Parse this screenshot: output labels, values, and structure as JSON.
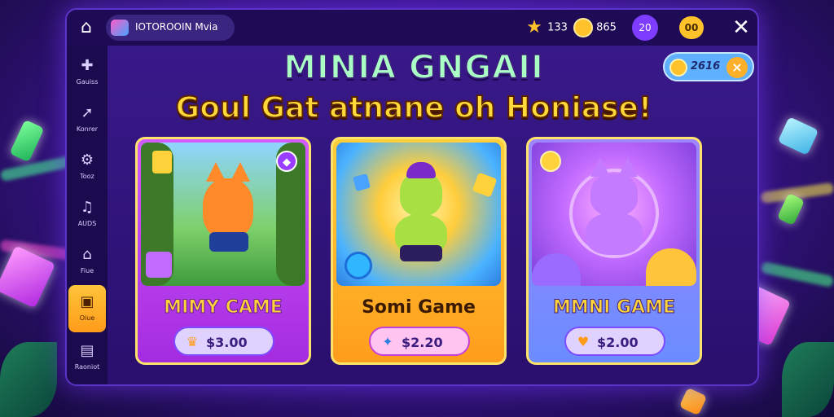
{
  "topbar": {
    "app_title": "IOTOROOIN  Mvia",
    "stats": [
      {
        "icon": "star-icon",
        "value": "133"
      },
      {
        "icon": "coin-icon",
        "value": "865"
      }
    ],
    "purple_badge": "20",
    "gold_badge": "00"
  },
  "sidebar": {
    "items": [
      {
        "icon": "gamepad-icon",
        "label": "Gauiss"
      },
      {
        "icon": "arrow-icon",
        "label": "Konrer"
      },
      {
        "icon": "gear-icon",
        "label": "Tooz"
      },
      {
        "icon": "music-note-icon",
        "label": "AUDS"
      },
      {
        "icon": "home-icon",
        "label": "Fiue"
      },
      {
        "icon": "card-icon",
        "label": "Oiue"
      },
      {
        "icon": "book-icon",
        "label": "Raoniot"
      }
    ],
    "active_index": 5
  },
  "header": {
    "title": "MINIA GNGAII",
    "subtitle": "Goul Gat atnane oh Honiase!"
  },
  "currency": {
    "value": "2616",
    "close": "×"
  },
  "cards": [
    {
      "name": "MIMY CAME",
      "price": "$3.00",
      "price_icon": "crown-icon"
    },
    {
      "name": "Somi Game",
      "price": "$2.20",
      "price_icon": "sparkle-icon"
    },
    {
      "name": "MMNI GAME",
      "price": "$2.00",
      "price_icon": "heart-icon"
    }
  ],
  "colors": {
    "accent_gold": "#ffd83a",
    "panel": "#2a0f6e",
    "title_green": "#aaffc4"
  }
}
